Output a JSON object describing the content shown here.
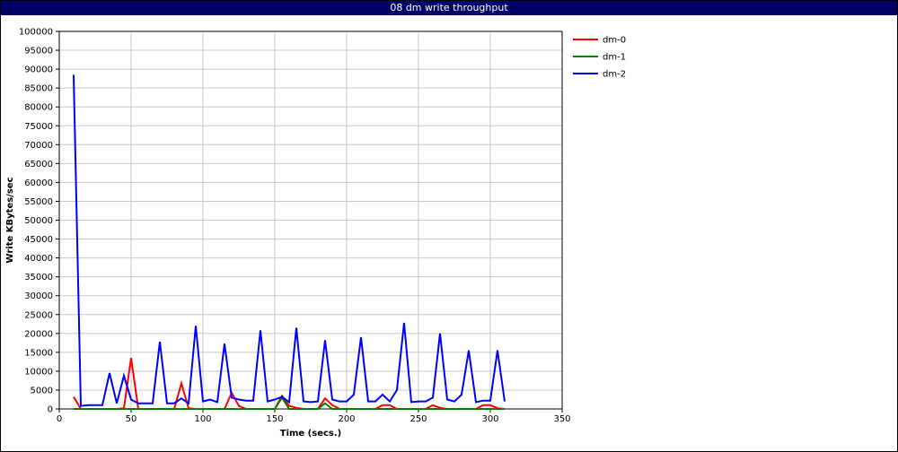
{
  "window": {
    "title": "08 dm write throughput"
  },
  "colors": {
    "title_bg": "#000066"
  },
  "chart_data": {
    "type": "line",
    "title": "08 dm write throughput",
    "xlabel": "Time (secs.)",
    "ylabel": "Write KBytes/sec",
    "xlim": [
      0,
      350
    ],
    "ylim": [
      0,
      100000
    ],
    "xticks": [
      0,
      50,
      100,
      150,
      200,
      250,
      300,
      350
    ],
    "yticks": [
      0,
      5000,
      10000,
      15000,
      20000,
      25000,
      30000,
      35000,
      40000,
      45000,
      50000,
      55000,
      60000,
      65000,
      70000,
      75000,
      80000,
      85000,
      90000,
      95000,
      100000
    ],
    "grid": true,
    "legend_position": "top-right",
    "x": [
      10,
      15,
      20,
      25,
      30,
      35,
      40,
      45,
      50,
      55,
      60,
      65,
      70,
      75,
      80,
      85,
      90,
      95,
      100,
      105,
      110,
      115,
      120,
      125,
      130,
      135,
      140,
      145,
      150,
      155,
      160,
      165,
      170,
      175,
      180,
      185,
      190,
      195,
      200,
      205,
      210,
      215,
      220,
      225,
      230,
      235,
      240,
      245,
      250,
      255,
      260,
      265,
      270,
      275,
      280,
      285,
      290,
      295,
      300,
      305,
      310
    ],
    "series": [
      {
        "name": "dm-0",
        "color": "#ff0000",
        "values": [
          3200,
          0,
          0,
          0,
          0,
          0,
          0,
          200,
          13500,
          0,
          0,
          0,
          0,
          0,
          0,
          6800,
          200,
          0,
          0,
          0,
          0,
          0,
          4300,
          800,
          0,
          0,
          0,
          0,
          0,
          3500,
          800,
          300,
          0,
          0,
          0,
          2800,
          1000,
          0,
          0,
          0,
          0,
          0,
          0,
          1000,
          1000,
          0,
          0,
          0,
          0,
          0,
          1000,
          300,
          0,
          0,
          0,
          0,
          0,
          1000,
          1000,
          200,
          0
        ]
      },
      {
        "name": "dm-1",
        "color": "#008000",
        "values": [
          0,
          0,
          0,
          0,
          0,
          0,
          0,
          0,
          0,
          0,
          0,
          0,
          0,
          0,
          0,
          0,
          0,
          0,
          0,
          0,
          0,
          0,
          0,
          0,
          0,
          0,
          0,
          0,
          0,
          3000,
          0,
          0,
          0,
          0,
          0,
          1500,
          0,
          0,
          0,
          0,
          0,
          0,
          0,
          0,
          0,
          0,
          0,
          0,
          0,
          0,
          0,
          0,
          0,
          0,
          0,
          0,
          0,
          0,
          0,
          0,
          0
        ]
      },
      {
        "name": "dm-2",
        "color": "#0000ff",
        "values": [
          88500,
          800,
          1000,
          1000,
          1000,
          9500,
          1500,
          8800,
          2500,
          1500,
          1500,
          1500,
          17800,
          1500,
          1500,
          2800,
          1500,
          22000,
          2000,
          2500,
          1800,
          17300,
          3000,
          2500,
          2200,
          2200,
          20800,
          2000,
          2500,
          3200,
          1800,
          21500,
          2000,
          1800,
          2000,
          18200,
          2500,
          2000,
          2000,
          3800,
          19000,
          2000,
          2000,
          3800,
          2000,
          5000,
          22800,
          1800,
          2000,
          2000,
          3000,
          20000,
          2500,
          2000,
          3800,
          15500,
          1800,
          2200,
          2200,
          15500,
          2000
        ]
      }
    ]
  }
}
